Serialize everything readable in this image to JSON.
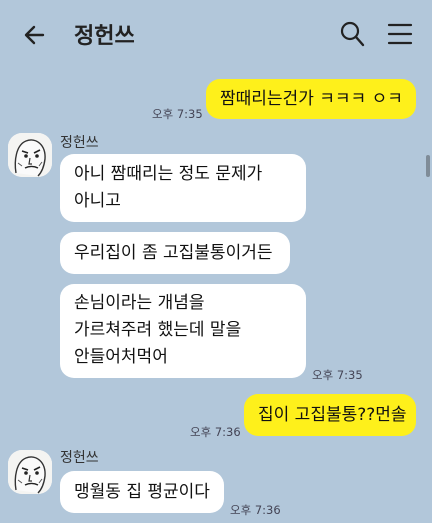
{
  "header": {
    "title": "정헌쓰",
    "icons": {
      "back": "arrow-left-icon",
      "search": "search-icon",
      "menu": "hamburger-menu-icon"
    }
  },
  "colors": {
    "background": "#b2c7da",
    "my_bubble": "#fef01b",
    "their_bubble": "#ffffff"
  },
  "messages": [
    {
      "from": "me",
      "text": "짬때리는건가 ㅋㅋㅋ ㅇㅋ",
      "time": "오후 7:35"
    },
    {
      "from": "other",
      "sender": "정헌쓰",
      "text": "아니 짬때리는 정도 문제가\n아니고"
    },
    {
      "from": "other",
      "text": "우리집이 좀 고집불통이거든"
    },
    {
      "from": "other",
      "text": "손님이라는 개념을\n가르쳐주려 했는데 말을\n안들어처먹어",
      "time": "오후 7:35"
    },
    {
      "from": "me",
      "text": "집이 고집불통??먼솔",
      "time": "오후 7:36"
    },
    {
      "from": "other",
      "sender": "정헌쓰",
      "text": "맹월동 집 평균이다",
      "time": "오후 7:36"
    }
  ]
}
